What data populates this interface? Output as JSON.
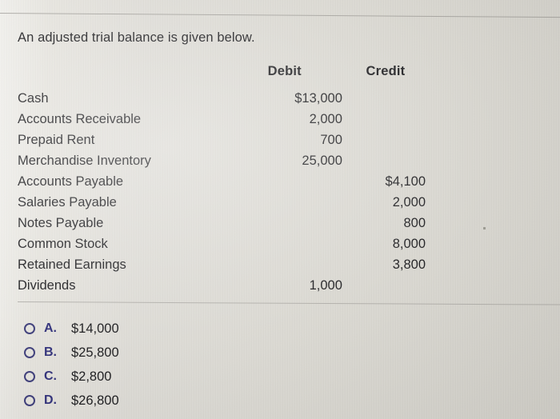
{
  "prompt": "An adjusted trial balance is given below.",
  "table": {
    "headers": {
      "account": "",
      "debit": "Debit",
      "credit": "Credit"
    },
    "rows": [
      {
        "account": "Cash",
        "debit": "$13,000",
        "credit": ""
      },
      {
        "account": "Accounts Receivable",
        "debit": "2,000",
        "credit": ""
      },
      {
        "account": "Prepaid Rent",
        "debit": "700",
        "credit": ""
      },
      {
        "account": "Merchandise Inventory",
        "debit": "25,000",
        "credit": ""
      },
      {
        "account": "Accounts Payable",
        "debit": "",
        "credit": "$4,100"
      },
      {
        "account": "Salaries Payable",
        "debit": "",
        "credit": "2,000"
      },
      {
        "account": "Notes Payable",
        "debit": "",
        "credit": "800"
      },
      {
        "account": "Common Stock",
        "debit": "",
        "credit": "8,000"
      },
      {
        "account": "Retained Earnings",
        "debit": "",
        "credit": "3,800"
      },
      {
        "account": "Dividends",
        "debit": "1,000",
        "credit": ""
      }
    ]
  },
  "choices": [
    {
      "letter": "A.",
      "value": "$14,000"
    },
    {
      "letter": "B.",
      "value": "$25,800"
    },
    {
      "letter": "C.",
      "value": "$2,800"
    },
    {
      "letter": "D.",
      "value": "$26,800"
    }
  ],
  "colors": {
    "page_background": "#d9d7d0",
    "text": "#17171a",
    "choice_accent": "#2e2e78",
    "rule": "#9c9a95"
  }
}
